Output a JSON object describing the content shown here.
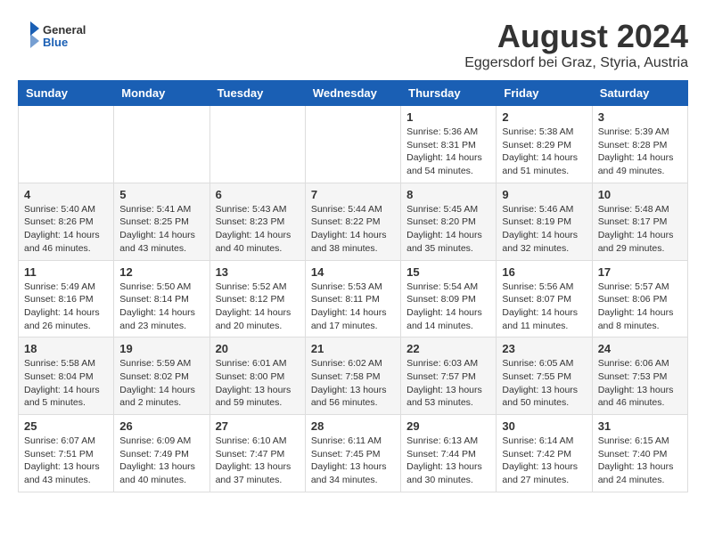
{
  "header": {
    "logo_general": "General",
    "logo_blue": "Blue",
    "month_year": "August 2024",
    "location": "Eggersdorf bei Graz, Styria, Austria"
  },
  "days_of_week": [
    "Sunday",
    "Monday",
    "Tuesday",
    "Wednesday",
    "Thursday",
    "Friday",
    "Saturday"
  ],
  "weeks": [
    [
      {
        "day": "",
        "info": ""
      },
      {
        "day": "",
        "info": ""
      },
      {
        "day": "",
        "info": ""
      },
      {
        "day": "",
        "info": ""
      },
      {
        "day": "1",
        "info": "Sunrise: 5:36 AM\nSunset: 8:31 PM\nDaylight: 14 hours\nand 54 minutes."
      },
      {
        "day": "2",
        "info": "Sunrise: 5:38 AM\nSunset: 8:29 PM\nDaylight: 14 hours\nand 51 minutes."
      },
      {
        "day": "3",
        "info": "Sunrise: 5:39 AM\nSunset: 8:28 PM\nDaylight: 14 hours\nand 49 minutes."
      }
    ],
    [
      {
        "day": "4",
        "info": "Sunrise: 5:40 AM\nSunset: 8:26 PM\nDaylight: 14 hours\nand 46 minutes."
      },
      {
        "day": "5",
        "info": "Sunrise: 5:41 AM\nSunset: 8:25 PM\nDaylight: 14 hours\nand 43 minutes."
      },
      {
        "day": "6",
        "info": "Sunrise: 5:43 AM\nSunset: 8:23 PM\nDaylight: 14 hours\nand 40 minutes."
      },
      {
        "day": "7",
        "info": "Sunrise: 5:44 AM\nSunset: 8:22 PM\nDaylight: 14 hours\nand 38 minutes."
      },
      {
        "day": "8",
        "info": "Sunrise: 5:45 AM\nSunset: 8:20 PM\nDaylight: 14 hours\nand 35 minutes."
      },
      {
        "day": "9",
        "info": "Sunrise: 5:46 AM\nSunset: 8:19 PM\nDaylight: 14 hours\nand 32 minutes."
      },
      {
        "day": "10",
        "info": "Sunrise: 5:48 AM\nSunset: 8:17 PM\nDaylight: 14 hours\nand 29 minutes."
      }
    ],
    [
      {
        "day": "11",
        "info": "Sunrise: 5:49 AM\nSunset: 8:16 PM\nDaylight: 14 hours\nand 26 minutes."
      },
      {
        "day": "12",
        "info": "Sunrise: 5:50 AM\nSunset: 8:14 PM\nDaylight: 14 hours\nand 23 minutes."
      },
      {
        "day": "13",
        "info": "Sunrise: 5:52 AM\nSunset: 8:12 PM\nDaylight: 14 hours\nand 20 minutes."
      },
      {
        "day": "14",
        "info": "Sunrise: 5:53 AM\nSunset: 8:11 PM\nDaylight: 14 hours\nand 17 minutes."
      },
      {
        "day": "15",
        "info": "Sunrise: 5:54 AM\nSunset: 8:09 PM\nDaylight: 14 hours\nand 14 minutes."
      },
      {
        "day": "16",
        "info": "Sunrise: 5:56 AM\nSunset: 8:07 PM\nDaylight: 14 hours\nand 11 minutes."
      },
      {
        "day": "17",
        "info": "Sunrise: 5:57 AM\nSunset: 8:06 PM\nDaylight: 14 hours\nand 8 minutes."
      }
    ],
    [
      {
        "day": "18",
        "info": "Sunrise: 5:58 AM\nSunset: 8:04 PM\nDaylight: 14 hours\nand 5 minutes."
      },
      {
        "day": "19",
        "info": "Sunrise: 5:59 AM\nSunset: 8:02 PM\nDaylight: 14 hours\nand 2 minutes."
      },
      {
        "day": "20",
        "info": "Sunrise: 6:01 AM\nSunset: 8:00 PM\nDaylight: 13 hours\nand 59 minutes."
      },
      {
        "day": "21",
        "info": "Sunrise: 6:02 AM\nSunset: 7:58 PM\nDaylight: 13 hours\nand 56 minutes."
      },
      {
        "day": "22",
        "info": "Sunrise: 6:03 AM\nSunset: 7:57 PM\nDaylight: 13 hours\nand 53 minutes."
      },
      {
        "day": "23",
        "info": "Sunrise: 6:05 AM\nSunset: 7:55 PM\nDaylight: 13 hours\nand 50 minutes."
      },
      {
        "day": "24",
        "info": "Sunrise: 6:06 AM\nSunset: 7:53 PM\nDaylight: 13 hours\nand 46 minutes."
      }
    ],
    [
      {
        "day": "25",
        "info": "Sunrise: 6:07 AM\nSunset: 7:51 PM\nDaylight: 13 hours\nand 43 minutes."
      },
      {
        "day": "26",
        "info": "Sunrise: 6:09 AM\nSunset: 7:49 PM\nDaylight: 13 hours\nand 40 minutes."
      },
      {
        "day": "27",
        "info": "Sunrise: 6:10 AM\nSunset: 7:47 PM\nDaylight: 13 hours\nand 37 minutes."
      },
      {
        "day": "28",
        "info": "Sunrise: 6:11 AM\nSunset: 7:45 PM\nDaylight: 13 hours\nand 34 minutes."
      },
      {
        "day": "29",
        "info": "Sunrise: 6:13 AM\nSunset: 7:44 PM\nDaylight: 13 hours\nand 30 minutes."
      },
      {
        "day": "30",
        "info": "Sunrise: 6:14 AM\nSunset: 7:42 PM\nDaylight: 13 hours\nand 27 minutes."
      },
      {
        "day": "31",
        "info": "Sunrise: 6:15 AM\nSunset: 7:40 PM\nDaylight: 13 hours\nand 24 minutes."
      }
    ]
  ]
}
